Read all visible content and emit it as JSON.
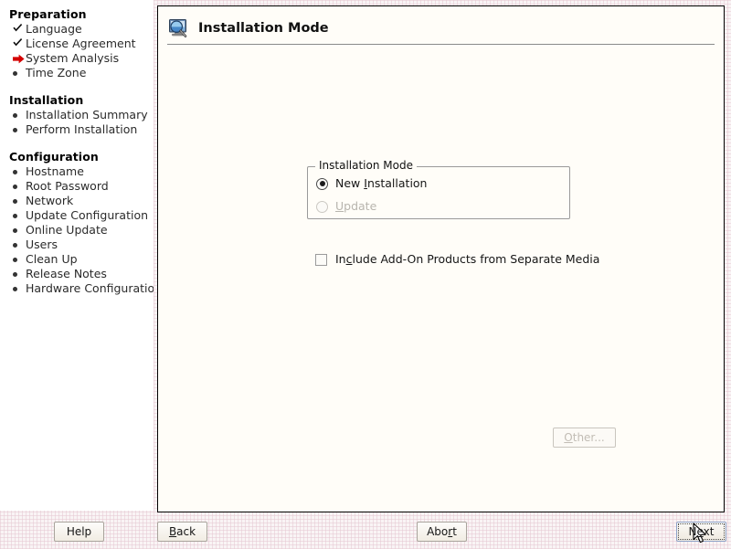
{
  "window": {
    "panel_title": "Installation Mode",
    "heading_icon": "monitor-magnifier-icon"
  },
  "sidebar": {
    "sections": [
      {
        "title": "Preparation",
        "items": [
          {
            "label": "Language",
            "state": "done",
            "marker": "check-icon"
          },
          {
            "label": "License Agreement",
            "state": "done",
            "marker": "check-icon"
          },
          {
            "label": "System Analysis",
            "state": "current",
            "marker": "right-arrow-icon"
          },
          {
            "label": "Time Zone",
            "state": "pending",
            "marker": "bullet-icon"
          }
        ]
      },
      {
        "title": "Installation",
        "items": [
          {
            "label": "Installation Summary",
            "state": "pending",
            "marker": "bullet-icon"
          },
          {
            "label": "Perform Installation",
            "state": "pending",
            "marker": "bullet-icon"
          }
        ]
      },
      {
        "title": "Configuration",
        "items": [
          {
            "label": "Hostname",
            "state": "pending",
            "marker": "bullet-icon"
          },
          {
            "label": "Root Password",
            "state": "pending",
            "marker": "bullet-icon"
          },
          {
            "label": "Network",
            "state": "pending",
            "marker": "bullet-icon"
          },
          {
            "label": "Update Configuration",
            "state": "pending",
            "marker": "bullet-icon"
          },
          {
            "label": "Online Update",
            "state": "pending",
            "marker": "bullet-icon"
          },
          {
            "label": "Users",
            "state": "pending",
            "marker": "bullet-icon"
          },
          {
            "label": "Clean Up",
            "state": "pending",
            "marker": "bullet-icon"
          },
          {
            "label": "Release Notes",
            "state": "pending",
            "marker": "bullet-icon"
          },
          {
            "label": "Hardware Configuration",
            "state": "pending",
            "marker": "bullet-icon"
          }
        ]
      }
    ]
  },
  "main": {
    "groupbox": {
      "legend": "Installation Mode",
      "options": [
        {
          "label_before": "New ",
          "accel": "I",
          "label_after": "nstallation",
          "selected": true,
          "enabled": true
        },
        {
          "label_before": "",
          "accel": "U",
          "label_after": "pdate",
          "selected": false,
          "enabled": false
        }
      ]
    },
    "addon_checkbox": {
      "label_before": "In",
      "accel": "c",
      "label_after": "lude Add-On Products from Separate Media",
      "checked": false
    },
    "other_button": {
      "label_before": "",
      "accel": "O",
      "label_after": "ther...",
      "enabled": false
    }
  },
  "footer": {
    "help": {
      "label_before": "Help",
      "accel": "",
      "label_after": ""
    },
    "back": {
      "label_before": "",
      "accel": "B",
      "label_after": "ack"
    },
    "abort": {
      "label_before": "Abo",
      "accel": "r",
      "label_after": "t"
    },
    "next": {
      "label_before": "N",
      "accel": "e",
      "label_after": "xt"
    }
  },
  "colors": {
    "panel_background": "#fffdf8",
    "sidebar_background": "#ffffff",
    "window_background": "#f9f4f5",
    "current_step_marker": "#d40000",
    "focus_border": "#8ea2c8"
  }
}
